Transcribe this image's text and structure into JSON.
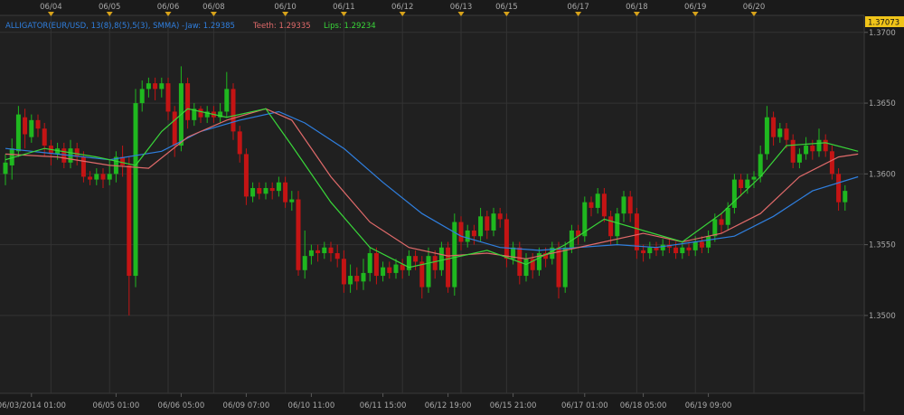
{
  "indicator": {
    "label": "ALLIGATOR(EUR/USD, 13(8),8(5),5(3), SMMA) -",
    "jaw": "Jaw: 1.29385",
    "teeth": "Teeth: 1.29335",
    "lips": "Lips: 1.29234"
  },
  "price_tag": "1.37073",
  "colors": {
    "background": "#1a1a1a",
    "plot_background": "#202020",
    "grid": "#333333",
    "axis_text": "#a8a8a8",
    "bull": "#1fb81f",
    "bear": "#c41414",
    "jaw": "#2f7fdf",
    "teeth": "#e06a6a",
    "lips": "#39d639",
    "marker": "#d7a21a",
    "price_tag_bg": "#f0c419"
  },
  "chart_data": {
    "type": "candlestick",
    "instrument": "EUR/USD",
    "ylim": [
      1.3445,
      1.3712
    ],
    "y_ticks": [
      1.35,
      1.355,
      1.36,
      1.365,
      1.37
    ],
    "y_tick_labels": [
      "1.3500",
      "1.3550",
      "1.3600",
      "1.3650",
      "1.3700"
    ],
    "top_labels": [
      {
        "label": "06/04",
        "i": 7
      },
      {
        "label": "06/05",
        "i": 16
      },
      {
        "label": "06/06",
        "i": 25
      },
      {
        "label": "06/08",
        "i": 32
      },
      {
        "label": "06/10",
        "i": 43
      },
      {
        "label": "06/11",
        "i": 52
      },
      {
        "label": "06/12",
        "i": 61
      },
      {
        "label": "06/13",
        "i": 70
      },
      {
        "label": "06/15",
        "i": 77
      },
      {
        "label": "06/17",
        "i": 88
      },
      {
        "label": "06/18",
        "i": 97
      },
      {
        "label": "06/19",
        "i": 106
      },
      {
        "label": "06/20",
        "i": 115
      }
    ],
    "bottom_labels": [
      {
        "label": "06/03/2014 01:00",
        "i": 4
      },
      {
        "label": "06/05 01:00",
        "i": 17
      },
      {
        "label": "06/06 05:00",
        "i": 27
      },
      {
        "label": "06/09 07:00",
        "i": 37
      },
      {
        "label": "06/10 11:00",
        "i": 47
      },
      {
        "label": "06/11 15:00",
        "i": 58
      },
      {
        "label": "06/12 19:00",
        "i": 68
      },
      {
        "label": "06/15 21:00",
        "i": 78
      },
      {
        "label": "06/17 01:00",
        "i": 89
      },
      {
        "label": "06/18 05:00",
        "i": 98
      },
      {
        "label": "06/19 09:00",
        "i": 108
      }
    ],
    "candles": [
      [
        1.36,
        1.3608,
        1.3592,
        1.3614
      ],
      [
        1.3606,
        1.3618,
        1.3596,
        1.3625
      ],
      [
        1.3616,
        1.3642,
        1.3612,
        1.3648
      ],
      [
        1.364,
        1.3628,
        1.3618,
        1.3646
      ],
      [
        1.3626,
        1.3638,
        1.3622,
        1.3642
      ],
      [
        1.3638,
        1.3632,
        1.3626,
        1.3642
      ],
      [
        1.3632,
        1.362,
        1.3612,
        1.3636
      ],
      [
        1.362,
        1.3614,
        1.3606,
        1.3624
      ],
      [
        1.3614,
        1.3618,
        1.361,
        1.3622
      ],
      [
        1.3618,
        1.3608,
        1.3604,
        1.3622
      ],
      [
        1.3608,
        1.3618,
        1.3604,
        1.3624
      ],
      [
        1.3618,
        1.3612,
        1.3606,
        1.3622
      ],
      [
        1.3612,
        1.3598,
        1.3594,
        1.3616
      ],
      [
        1.3598,
        1.3596,
        1.3592,
        1.3602
      ],
      [
        1.3596,
        1.36,
        1.3592,
        1.3604
      ],
      [
        1.36,
        1.3596,
        1.359,
        1.3604
      ],
      [
        1.3596,
        1.36,
        1.3592,
        1.361
      ],
      [
        1.36,
        1.3612,
        1.3594,
        1.3616
      ],
      [
        1.3612,
        1.3606,
        1.3598,
        1.362
      ],
      [
        1.3606,
        1.3528,
        1.35,
        1.3612
      ],
      [
        1.3528,
        1.365,
        1.352,
        1.366
      ],
      [
        1.365,
        1.366,
        1.3644,
        1.3666
      ],
      [
        1.366,
        1.3664,
        1.3654,
        1.3668
      ],
      [
        1.3664,
        1.366,
        1.3652,
        1.3668
      ],
      [
        1.366,
        1.3664,
        1.3654,
        1.3668
      ],
      [
        1.3664,
        1.3644,
        1.3638,
        1.3668
      ],
      [
        1.3644,
        1.362,
        1.3612,
        1.3648
      ],
      [
        1.362,
        1.3664,
        1.3616,
        1.3676
      ],
      [
        1.3664,
        1.3638,
        1.3632,
        1.3668
      ],
      [
        1.3638,
        1.3646,
        1.3634,
        1.365
      ],
      [
        1.3646,
        1.364,
        1.3636,
        1.3648
      ],
      [
        1.364,
        1.3644,
        1.3636,
        1.3648
      ],
      [
        1.3644,
        1.364,
        1.3636,
        1.3648
      ],
      [
        1.364,
        1.3644,
        1.3636,
        1.365
      ],
      [
        1.3644,
        1.366,
        1.364,
        1.3672
      ],
      [
        1.366,
        1.363,
        1.3624,
        1.3664
      ],
      [
        1.363,
        1.3614,
        1.3608,
        1.3634
      ],
      [
        1.3614,
        1.3584,
        1.3578,
        1.3618
      ],
      [
        1.3584,
        1.359,
        1.358,
        1.3594
      ],
      [
        1.359,
        1.3586,
        1.3582,
        1.3594
      ],
      [
        1.3586,
        1.359,
        1.3582,
        1.3594
      ],
      [
        1.359,
        1.3588,
        1.3582,
        1.3594
      ],
      [
        1.3588,
        1.3594,
        1.3584,
        1.3598
      ],
      [
        1.3594,
        1.358,
        1.3576,
        1.3598
      ],
      [
        1.358,
        1.3582,
        1.3574,
        1.3588
      ],
      [
        1.3582,
        1.3532,
        1.3528,
        1.3588
      ],
      [
        1.3532,
        1.3542,
        1.3526,
        1.356
      ],
      [
        1.3542,
        1.3546,
        1.3536,
        1.355
      ],
      [
        1.3546,
        1.3544,
        1.3538,
        1.355
      ],
      [
        1.3544,
        1.3548,
        1.354,
        1.3552
      ],
      [
        1.3548,
        1.3544,
        1.3538,
        1.3552
      ],
      [
        1.3544,
        1.354,
        1.3534,
        1.355
      ],
      [
        1.354,
        1.3522,
        1.3516,
        1.3546
      ],
      [
        1.3522,
        1.3528,
        1.3516,
        1.3536
      ],
      [
        1.3528,
        1.3524,
        1.3518,
        1.3534
      ],
      [
        1.3524,
        1.353,
        1.3518,
        1.354
      ],
      [
        1.353,
        1.3544,
        1.3524,
        1.3548
      ],
      [
        1.3544,
        1.3528,
        1.3522,
        1.3548
      ],
      [
        1.3528,
        1.3534,
        1.3524,
        1.3538
      ],
      [
        1.3534,
        1.353,
        1.3526,
        1.3538
      ],
      [
        1.353,
        1.3536,
        1.3526,
        1.354
      ],
      [
        1.3536,
        1.3532,
        1.3526,
        1.354
      ],
      [
        1.3532,
        1.3542,
        1.3528,
        1.3546
      ],
      [
        1.3542,
        1.3538,
        1.3532,
        1.3546
      ],
      [
        1.3538,
        1.352,
        1.3512,
        1.3542
      ],
      [
        1.352,
        1.3542,
        1.3516,
        1.3548
      ],
      [
        1.3542,
        1.3532,
        1.3526,
        1.3546
      ],
      [
        1.3532,
        1.3548,
        1.3528,
        1.3552
      ],
      [
        1.3548,
        1.352,
        1.3516,
        1.3552
      ],
      [
        1.352,
        1.3566,
        1.3514,
        1.3572
      ],
      [
        1.3566,
        1.3552,
        1.3546,
        1.357
      ],
      [
        1.3552,
        1.356,
        1.3548,
        1.3564
      ],
      [
        1.356,
        1.3556,
        1.355,
        1.3564
      ],
      [
        1.3556,
        1.357,
        1.3552,
        1.3576
      ],
      [
        1.357,
        1.356,
        1.3554,
        1.3574
      ],
      [
        1.356,
        1.3572,
        1.3556,
        1.3576
      ],
      [
        1.3572,
        1.3568,
        1.3562,
        1.3576
      ],
      [
        1.3568,
        1.354,
        1.3534,
        1.3572
      ],
      [
        1.354,
        1.3548,
        1.3536,
        1.3552
      ],
      [
        1.3548,
        1.3528,
        1.3522,
        1.3552
      ],
      [
        1.3528,
        1.354,
        1.3524,
        1.3544
      ],
      [
        1.354,
        1.3532,
        1.3526,
        1.3544
      ],
      [
        1.3532,
        1.3544,
        1.3528,
        1.3548
      ],
      [
        1.3544,
        1.354,
        1.3534,
        1.3548
      ],
      [
        1.354,
        1.3548,
        1.3536,
        1.3552
      ],
      [
        1.3548,
        1.352,
        1.3512,
        1.3552
      ],
      [
        1.352,
        1.3548,
        1.3516,
        1.3552
      ],
      [
        1.3548,
        1.356,
        1.3544,
        1.3564
      ],
      [
        1.356,
        1.3556,
        1.355,
        1.3564
      ],
      [
        1.3556,
        1.358,
        1.3552,
        1.3584
      ],
      [
        1.358,
        1.3576,
        1.357,
        1.3584
      ],
      [
        1.3576,
        1.3586,
        1.3572,
        1.359
      ],
      [
        1.3586,
        1.357,
        1.3566,
        1.359
      ],
      [
        1.357,
        1.3556,
        1.355,
        1.3574
      ],
      [
        1.3556,
        1.3572,
        1.355,
        1.3576
      ],
      [
        1.3572,
        1.3584,
        1.3566,
        1.3588
      ],
      [
        1.3584,
        1.3572,
        1.3566,
        1.3588
      ],
      [
        1.3572,
        1.3546,
        1.354,
        1.3576
      ],
      [
        1.3546,
        1.3544,
        1.3538,
        1.355
      ],
      [
        1.3544,
        1.3548,
        1.354,
        1.3552
      ],
      [
        1.3548,
        1.3546,
        1.3542,
        1.3552
      ],
      [
        1.3546,
        1.355,
        1.3542,
        1.3554
      ],
      [
        1.355,
        1.3548,
        1.3544,
        1.3554
      ],
      [
        1.3548,
        1.3544,
        1.354,
        1.3552
      ],
      [
        1.3544,
        1.3548,
        1.354,
        1.3552
      ],
      [
        1.3548,
        1.3546,
        1.3542,
        1.3552
      ],
      [
        1.3546,
        1.3552,
        1.3542,
        1.3556
      ],
      [
        1.3552,
        1.3548,
        1.3544,
        1.3556
      ],
      [
        1.3548,
        1.3556,
        1.3544,
        1.356
      ],
      [
        1.3556,
        1.3568,
        1.3552,
        1.3572
      ],
      [
        1.3568,
        1.3564,
        1.3558,
        1.3572
      ],
      [
        1.3564,
        1.3576,
        1.356,
        1.358
      ],
      [
        1.3576,
        1.3596,
        1.3572,
        1.36
      ],
      [
        1.3596,
        1.359,
        1.3584,
        1.36
      ],
      [
        1.359,
        1.3596,
        1.3586,
        1.36
      ],
      [
        1.3596,
        1.3598,
        1.359,
        1.3602
      ],
      [
        1.3598,
        1.3614,
        1.3594,
        1.362
      ],
      [
        1.3614,
        1.364,
        1.361,
        1.3648
      ],
      [
        1.364,
        1.3626,
        1.362,
        1.3644
      ],
      [
        1.3626,
        1.3632,
        1.3622,
        1.3636
      ],
      [
        1.3632,
        1.3624,
        1.3618,
        1.3636
      ],
      [
        1.3624,
        1.3608,
        1.3604,
        1.3628
      ],
      [
        1.3608,
        1.3614,
        1.3604,
        1.3618
      ],
      [
        1.3614,
        1.362,
        1.361,
        1.3626
      ],
      [
        1.362,
        1.3616,
        1.361,
        1.3624
      ],
      [
        1.3616,
        1.3624,
        1.3612,
        1.3632
      ],
      [
        1.3624,
        1.3616,
        1.3612,
        1.3628
      ],
      [
        1.3616,
        1.36,
        1.3596,
        1.362
      ],
      [
        1.36,
        1.358,
        1.3574,
        1.3604
      ],
      [
        1.358,
        1.3588,
        1.3574,
        1.3592
      ]
    ],
    "series": [
      {
        "name": "Jaw",
        "points": [
          [
            0,
            1.3618
          ],
          [
            8,
            1.3614
          ],
          [
            16,
            1.361
          ],
          [
            24,
            1.3616
          ],
          [
            30,
            1.363
          ],
          [
            36,
            1.3638
          ],
          [
            42,
            1.3644
          ],
          [
            46,
            1.3636
          ],
          [
            52,
            1.3618
          ],
          [
            58,
            1.3594
          ],
          [
            64,
            1.3572
          ],
          [
            70,
            1.3556
          ],
          [
            76,
            1.3548
          ],
          [
            82,
            1.3546
          ],
          [
            88,
            1.3548
          ],
          [
            94,
            1.355
          ],
          [
            100,
            1.3548
          ],
          [
            106,
            1.3552
          ],
          [
            112,
            1.3556
          ],
          [
            118,
            1.357
          ],
          [
            124,
            1.3588
          ],
          [
            131,
            1.3598
          ]
        ]
      },
      {
        "name": "Teeth",
        "points": [
          [
            0,
            1.3614
          ],
          [
            8,
            1.3612
          ],
          [
            16,
            1.3606
          ],
          [
            22,
            1.3604
          ],
          [
            28,
            1.3626
          ],
          [
            34,
            1.3638
          ],
          [
            40,
            1.3646
          ],
          [
            44,
            1.3638
          ],
          [
            50,
            1.3598
          ],
          [
            56,
            1.3566
          ],
          [
            62,
            1.3548
          ],
          [
            68,
            1.3542
          ],
          [
            74,
            1.3544
          ],
          [
            80,
            1.354
          ],
          [
            86,
            1.3546
          ],
          [
            92,
            1.3552
          ],
          [
            98,
            1.3558
          ],
          [
            104,
            1.3552
          ],
          [
            110,
            1.3558
          ],
          [
            116,
            1.3572
          ],
          [
            122,
            1.3598
          ],
          [
            128,
            1.3612
          ],
          [
            131,
            1.3614
          ]
        ]
      },
      {
        "name": "Lips",
        "points": [
          [
            0,
            1.361
          ],
          [
            6,
            1.3618
          ],
          [
            14,
            1.3612
          ],
          [
            20,
            1.3606
          ],
          [
            24,
            1.363
          ],
          [
            28,
            1.3646
          ],
          [
            34,
            1.364
          ],
          [
            40,
            1.3646
          ],
          [
            44,
            1.362
          ],
          [
            50,
            1.358
          ],
          [
            56,
            1.3548
          ],
          [
            62,
            1.3534
          ],
          [
            68,
            1.354
          ],
          [
            74,
            1.3546
          ],
          [
            80,
            1.3536
          ],
          [
            86,
            1.355
          ],
          [
            92,
            1.3568
          ],
          [
            98,
            1.356
          ],
          [
            104,
            1.3552
          ],
          [
            110,
            1.3572
          ],
          [
            116,
            1.3598
          ],
          [
            120,
            1.362
          ],
          [
            126,
            1.3622
          ],
          [
            131,
            1.3616
          ]
        ]
      }
    ]
  }
}
